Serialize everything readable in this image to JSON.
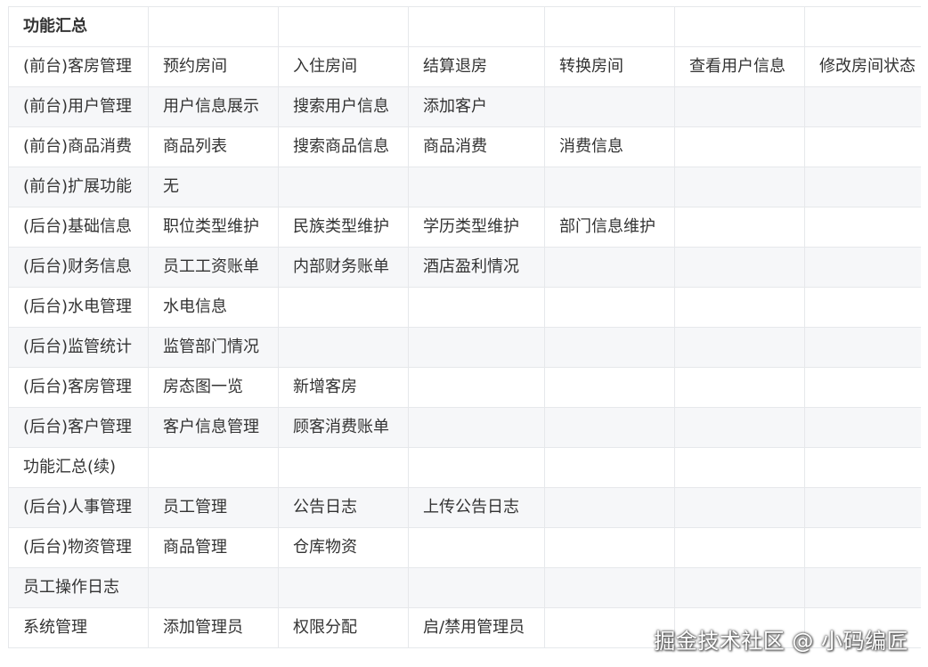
{
  "table": {
    "rows": [
      [
        "功能汇总",
        "",
        "",
        "",
        "",
        "",
        ""
      ],
      [
        "(前台)客房管理",
        "预约房间",
        "入住房间",
        "结算退房",
        "转换房间",
        "查看用户信息",
        "修改房间状态"
      ],
      [
        "(前台)用户管理",
        "用户信息展示",
        "搜索用户信息",
        "添加客户",
        "",
        "",
        ""
      ],
      [
        "(前台)商品消费",
        "商品列表",
        "搜索商品信息",
        "商品消费",
        "消费信息",
        "",
        ""
      ],
      [
        "(前台)扩展功能",
        "无",
        "",
        "",
        "",
        "",
        ""
      ],
      [
        "(后台)基础信息",
        "职位类型维护",
        "民族类型维护",
        "学历类型维护",
        "部门信息维护",
        "",
        ""
      ],
      [
        "(后台)财务信息",
        "员工工资账单",
        "内部财务账单",
        "酒店盈利情况",
        "",
        "",
        ""
      ],
      [
        "(后台)水电管理",
        "水电信息",
        "",
        "",
        "",
        "",
        ""
      ],
      [
        "(后台)监管统计",
        "监管部门情况",
        "",
        "",
        "",
        "",
        ""
      ],
      [
        "(后台)客房管理",
        "房态图一览",
        "新增客房",
        "",
        "",
        "",
        ""
      ],
      [
        "(后台)客户管理",
        "客户信息管理",
        "顾客消费账单",
        "",
        "",
        "",
        ""
      ],
      [
        "功能汇总(续)",
        "",
        "",
        "",
        "",
        "",
        ""
      ],
      [
        "(后台)人事管理",
        "员工管理",
        "公告日志",
        "上传公告日志",
        "",
        "",
        ""
      ],
      [
        "(后台)物资管理",
        "商品管理",
        "仓库物资",
        "",
        "",
        "",
        ""
      ],
      [
        "员工操作日志",
        "",
        "",
        "",
        "",
        "",
        ""
      ],
      [
        "系统管理",
        "添加管理员",
        "权限分配",
        "启/禁用管理员",
        "",
        "",
        ""
      ]
    ]
  },
  "watermark": "掘金技术社区 @ 小码编匠",
  "colors": {
    "border": "#e6e8eb",
    "stripe": "#f6f7f9",
    "text": "#333333"
  }
}
